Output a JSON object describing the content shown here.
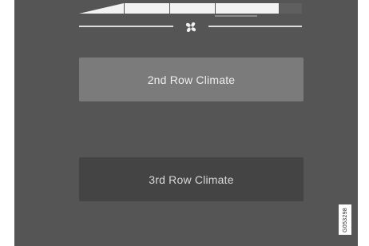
{
  "fan": {
    "icon": "fan-icon",
    "level_segments_filled": 4,
    "level_segments_total": 5
  },
  "buttons": {
    "row2_label": "2nd Row Climate",
    "row3_label": "3rd Row Climate"
  },
  "image_code": "G053298",
  "colors": {
    "screen_background": "#555555",
    "active_button": "#7b7b7b",
    "inactive_button": "#444444",
    "fan_segment": "#f2f2f2"
  }
}
